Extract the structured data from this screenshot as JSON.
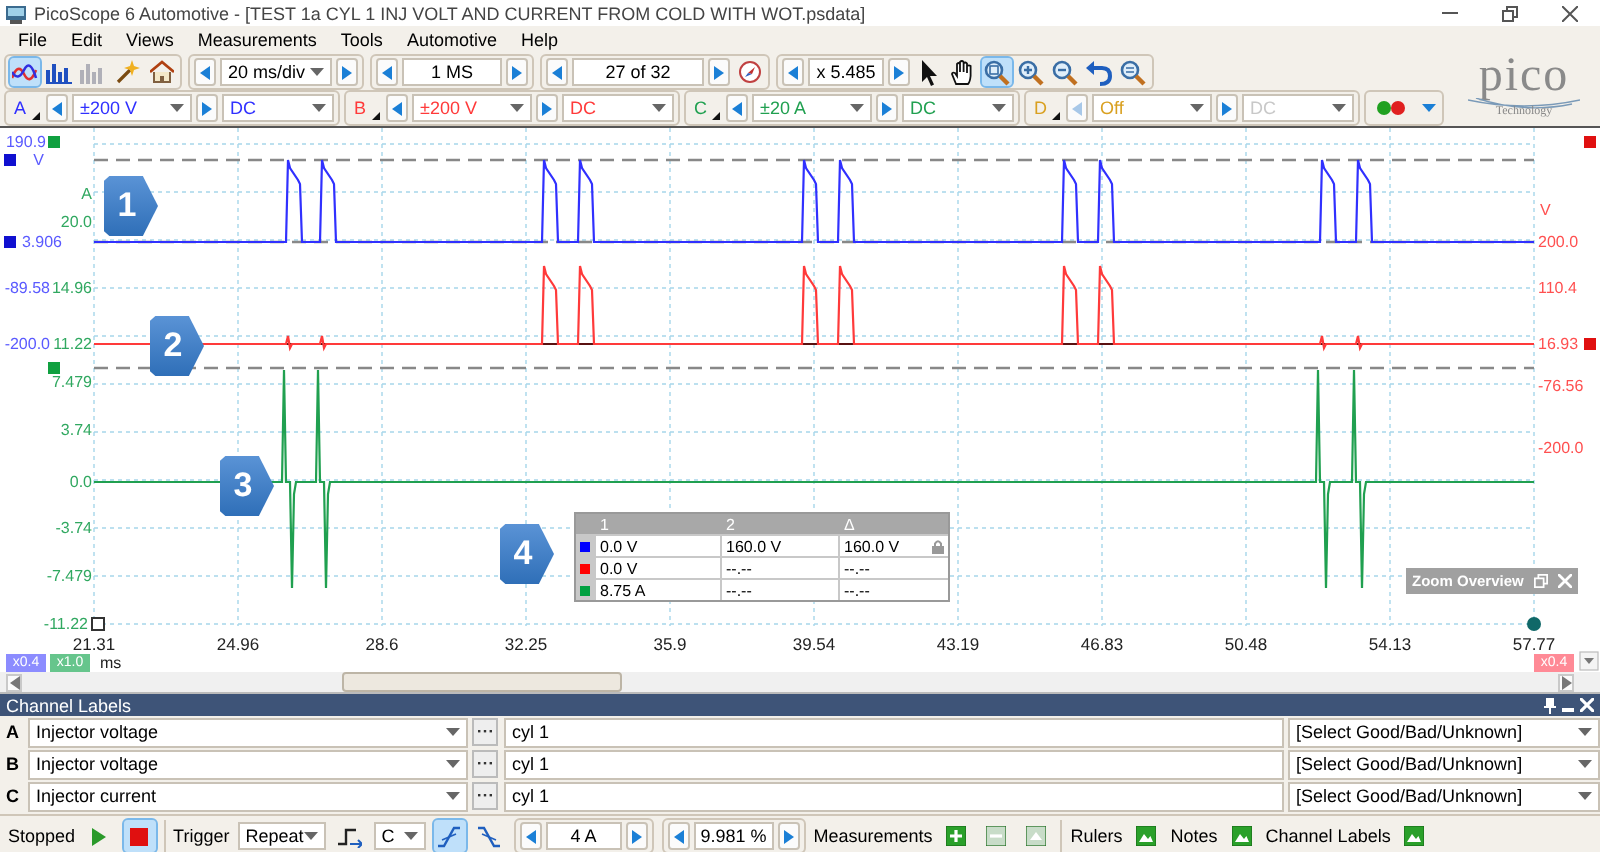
{
  "window": {
    "title": "PicoScope 6 Automotive - [TEST 1a CYL 1 INJ VOLT AND CURRENT FROM COLD WITH WOT.psdata]"
  },
  "menu": [
    "File",
    "Edit",
    "Views",
    "Measurements",
    "Tools",
    "Automotive",
    "Help"
  ],
  "toolbar": {
    "views": [
      {
        "kind": "scope",
        "selected": true
      },
      {
        "kind": "spectrum",
        "selected": false
      },
      {
        "kind": "persistence",
        "selected": false
      }
    ],
    "timebase": "20 ms/div",
    "samples": "1 MS",
    "buffer": "27 of 32",
    "zoom": "x 5.485",
    "tools": [
      {
        "kind": "pointer",
        "selected": false
      },
      {
        "kind": "hand",
        "selected": false
      },
      {
        "kind": "zoom-box",
        "selected": true
      },
      {
        "kind": "zoom-in",
        "selected": false
      },
      {
        "kind": "zoom-out",
        "selected": false
      },
      {
        "kind": "undo",
        "selected": false
      },
      {
        "kind": "zoom-fit",
        "selected": false
      }
    ]
  },
  "logo": {
    "wordmark": "pico",
    "tagline": "Technology"
  },
  "channels": [
    {
      "letter": "A",
      "range": "±200 V",
      "coupling": "DC",
      "color": "#3030ff",
      "disabled": false
    },
    {
      "letter": "B",
      "range": "±200 V",
      "coupling": "DC",
      "color": "#ff3a3a",
      "disabled": false
    },
    {
      "letter": "C",
      "range": "±20 A",
      "coupling": "DC",
      "color": "#20a050",
      "disabled": false
    },
    {
      "letter": "D",
      "range": "Off",
      "coupling": "DC",
      "color": "#d9a020",
      "disabled": true
    }
  ],
  "scope": {
    "left_axis": [
      {
        "text": "190.9",
        "color": "#5a5aff"
      },
      {
        "text": "V",
        "color": "#5a5aff"
      },
      {
        "text": "A",
        "color": "#30a860"
      },
      {
        "text": "20.0",
        "color": "#30a860"
      },
      {
        "text": "3.906",
        "color": "#5a5aff"
      },
      {
        "text": "-89.58",
        "color": "#5a5aff"
      },
      {
        "text": "14.96",
        "color": "#30a860"
      },
      {
        "text": "-200.0",
        "color": "#5a5aff"
      },
      {
        "text": "11.22",
        "color": "#30a860"
      },
      {
        "text": "7.479",
        "color": "#30a860"
      },
      {
        "text": "3.74",
        "color": "#30a860"
      },
      {
        "text": "0.0",
        "color": "#30a860"
      },
      {
        "text": "-3.74",
        "color": "#30a860"
      },
      {
        "text": "-7.479",
        "color": "#30a860"
      },
      {
        "text": "-11.22",
        "color": "#30a860"
      }
    ],
    "right_axis": [
      "V",
      "200.0",
      "110.4",
      "16.93",
      "-76.56",
      "-200.0"
    ],
    "x_ticks": [
      "21.31",
      "24.96",
      "28.6",
      "32.25",
      "35.9",
      "39.54",
      "43.19",
      "46.83",
      "50.48",
      "54.13",
      "57.77"
    ],
    "scale_tags": [
      {
        "text": "x0.4",
        "color": "#8c8cff"
      },
      {
        "text": "x1.0",
        "color": "#66c58c"
      }
    ],
    "x_unit": "ms",
    "right_tag": {
      "text": "x0.4",
      "color": "#ff8a96"
    },
    "callouts": [
      "1",
      "2",
      "3",
      "4"
    ],
    "measurements": {
      "columns": [
        "1",
        "2",
        "Δ"
      ],
      "rows": [
        {
          "color": "#0000ff",
          "values": [
            "0.0 V",
            "160.0 V",
            "160.0 V"
          ],
          "locked": true
        },
        {
          "color": "#ff0000",
          "values": [
            "0.0 V",
            "--.--",
            "--.--"
          ],
          "locked": false
        },
        {
          "color": "#00a040",
          "values": [
            "8.75 A",
            "--.--",
            "--.--"
          ],
          "locked": false
        }
      ]
    },
    "zoom_overview": "Zoom Overview"
  },
  "channel_labels": {
    "title": "Channel Labels",
    "rows": [
      {
        "letter": "A",
        "label": "Injector voltage",
        "note": "cyl 1",
        "verdict": "[Select Good/Bad/Unknown]"
      },
      {
        "letter": "B",
        "label": "Injector voltage",
        "note": "cyl 1",
        "verdict": "[Select Good/Bad/Unknown]"
      },
      {
        "letter": "C",
        "label": "Injector current",
        "note": "cyl 1",
        "verdict": "[Select Good/Bad/Unknown]"
      }
    ]
  },
  "status_bar": {
    "state": "Stopped",
    "run": [
      {
        "kind": "play",
        "selected": false
      },
      {
        "kind": "stop",
        "selected": true
      }
    ],
    "trigger_label": "Trigger",
    "trigger_mode": "Repeat",
    "trigger_source": "C",
    "edges": [
      {
        "kind": "rising",
        "selected": true
      },
      {
        "kind": "falling",
        "selected": false
      }
    ],
    "threshold": "4 A",
    "pretrigger": "9.981 %",
    "measurements_label": "Measurements",
    "measurement_buttons": [
      {
        "kind": "add",
        "disabled": false
      },
      {
        "kind": "remove",
        "disabled": true
      },
      {
        "kind": "edit",
        "disabled": true
      }
    ],
    "toggles": [
      "Rulers",
      "Notes",
      "Channel Labels"
    ]
  }
}
